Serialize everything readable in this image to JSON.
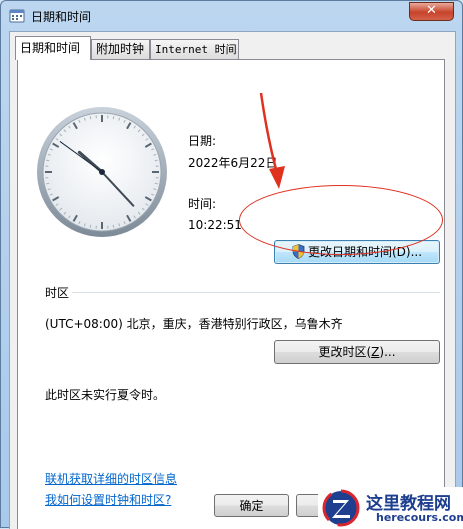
{
  "window": {
    "title": "日期和时间",
    "close_glyph": "✕"
  },
  "tabs": [
    {
      "label": "日期和时间"
    },
    {
      "label": "附加时钟"
    },
    {
      "label": "Internet 时间"
    }
  ],
  "datetime": {
    "date_label": "日期:",
    "date_value": "2022年6月22日",
    "time_label": "时间:",
    "time_value": "10:22:51",
    "change_button": "更改日期和时间(D)..."
  },
  "timezone": {
    "section_label": "时区",
    "value": "(UTC+08:00) 北京，重庆，香港特别行政区，乌鲁木齐",
    "change_button_pre": "更改时区(",
    "change_button_key": "Z",
    "change_button_post": ")...",
    "dst_note": "此时区未实行夏令时。"
  },
  "links": {
    "online_info": "联机获取详细的时区信息",
    "how_to": "我如何设置时钟和时区?"
  },
  "footer": {
    "ok_button": "确定"
  },
  "clock": {
    "hours": 10,
    "minutes": 22,
    "seconds": 51
  },
  "watermark": {
    "title": "这里教程网",
    "subtitle": "herecours.com"
  },
  "colors": {
    "annotation_red": "#e0301e",
    "link_blue": "#0066cc",
    "shield_blue": "#3a6fc4",
    "shield_yellow": "#f2c12e"
  }
}
